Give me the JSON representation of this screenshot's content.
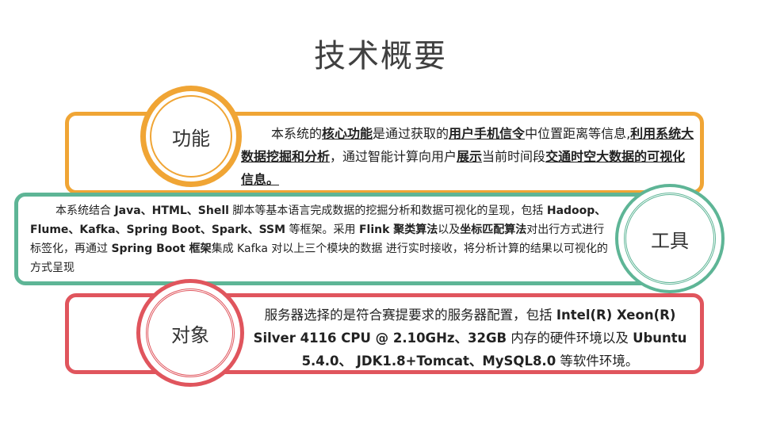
{
  "title": "技术概要",
  "colors": {
    "function": "#f0a535",
    "tools": "#5eb596",
    "object": "#e0555d"
  },
  "sections": {
    "function": {
      "label": "功能",
      "p1": "本系统的",
      "b1": "核心功能",
      "p2": "是通过获取的",
      "b2": "用户手机信令",
      "p3": "中位置距离等信息,",
      "b3": "利用系统大数据挖掘和分析",
      "p4": "，通过智能计算向用户",
      "b4": "展示",
      "p5": "当前时间段",
      "b5": "交通时空大数据的可视化信息。"
    },
    "tools": {
      "label": "工具",
      "p1": "本系统结合 ",
      "b1": "Java、HTML、Shell",
      "p2": " 脚本等基本语言完成数据的挖掘分析和数据可视化的呈现，包括 ",
      "b2": "Hadoop、Flume、Kafka、Spring Boot、Spark、SSM",
      "p3": " 等框架。采用 ",
      "b3": "Flink 聚类算法",
      "p4": "以及",
      "b4": "坐标匹配算法",
      "p5": "对出行方式进行标签化，再通过 ",
      "b5": "Spring Boot 框架",
      "p6": "集成 Kafka 对以上三个模块的数据 进行实时接收，将分析计算的结果以可视化的方式呈现"
    },
    "object": {
      "label": "对象",
      "p1": "服务器选择的是符合赛提要求的服务器配置，包括 ",
      "b1": "Intel(R) Xeon(R) Silver 4116 CPU @ 2.10GHz、32GB",
      "p2": " 内存的硬件环境以及 ",
      "b2": "Ubuntu 5.4.0、 JDK1.8+Tomcat、MySQL8.0",
      "p3": " 等软件环境。"
    }
  }
}
